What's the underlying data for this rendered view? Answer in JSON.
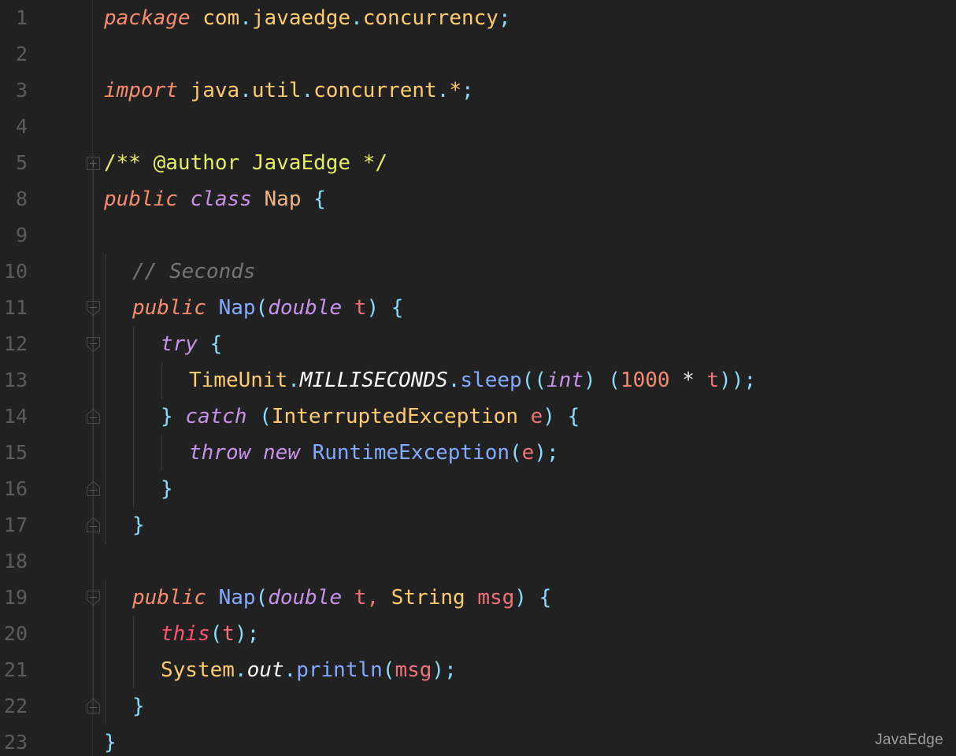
{
  "editor": {
    "language": "java",
    "filename": "Nap.java",
    "background": "#212121",
    "gutter_background": "#212121",
    "gutter_separator": "#2f2f2f",
    "line_number_color": "#5c5c5c",
    "line_height": 46,
    "font_size": 26
  },
  "watermark": {
    "text": "JavaEdge"
  },
  "gutter": {
    "line_numbers": [
      "1",
      "2",
      "3",
      "4",
      "5",
      "8",
      "9",
      "10",
      "11",
      "12",
      "13",
      "14",
      "15",
      "16",
      "17",
      "18",
      "19",
      "20",
      "21",
      "22",
      "23"
    ],
    "fold_markers": [
      {
        "line": "5",
        "row": 4,
        "type": "fold-collapsed-plus",
        "name": "fold-toggle-collapsed"
      },
      {
        "line": "11",
        "row": 8,
        "type": "fold-start",
        "name": "fold-toggle-start"
      },
      {
        "line": "12",
        "row": 9,
        "type": "fold-start",
        "name": "fold-toggle-start"
      },
      {
        "line": "14",
        "row": 11,
        "type": "fold-end",
        "name": "fold-toggle-end"
      },
      {
        "line": "16",
        "row": 13,
        "type": "fold-end",
        "name": "fold-toggle-end"
      },
      {
        "line": "17",
        "row": 14,
        "type": "fold-end",
        "name": "fold-toggle-end"
      },
      {
        "line": "19",
        "row": 16,
        "type": "fold-start",
        "name": "fold-toggle-start"
      },
      {
        "line": "22",
        "row": 19,
        "type": "fold-end",
        "name": "fold-toggle-end"
      }
    ]
  },
  "code_lines": [
    {
      "number": "1",
      "indent": 0,
      "tokens": [
        {
          "t": "package",
          "c": "t-kw"
        },
        {
          "t": " ",
          "c": "t-plain"
        },
        {
          "t": "com",
          "c": "t-pkg"
        },
        {
          "t": ".",
          "c": "t-punc"
        },
        {
          "t": "javaedge",
          "c": "t-pkg"
        },
        {
          "t": ".",
          "c": "t-punc"
        },
        {
          "t": "concurrency",
          "c": "t-pkg"
        },
        {
          "t": ";",
          "c": "t-punc"
        }
      ]
    },
    {
      "number": "2",
      "indent": 0,
      "tokens": []
    },
    {
      "number": "3",
      "indent": 0,
      "tokens": [
        {
          "t": "import",
          "c": "t-kw"
        },
        {
          "t": " ",
          "c": "t-plain"
        },
        {
          "t": "java",
          "c": "t-pkg"
        },
        {
          "t": ".",
          "c": "t-punc"
        },
        {
          "t": "util",
          "c": "t-pkg"
        },
        {
          "t": ".",
          "c": "t-punc"
        },
        {
          "t": "concurrent",
          "c": "t-pkg"
        },
        {
          "t": ".",
          "c": "t-punc"
        },
        {
          "t": "*",
          "c": "t-pkg"
        },
        {
          "t": ";",
          "c": "t-punc"
        }
      ]
    },
    {
      "number": "4",
      "indent": 0,
      "tokens": []
    },
    {
      "number": "5",
      "indent": 0,
      "tokens": [
        {
          "t": "/** @author JavaEdge */",
          "c": "t-doc"
        }
      ]
    },
    {
      "number": "8",
      "indent": 0,
      "tokens": [
        {
          "t": "public",
          "c": "t-kw"
        },
        {
          "t": " ",
          "c": "t-plain"
        },
        {
          "t": "class",
          "c": "t-kw2"
        },
        {
          "t": " ",
          "c": "t-plain"
        },
        {
          "t": "Nap",
          "c": "t-class"
        },
        {
          "t": " ",
          "c": "t-plain"
        },
        {
          "t": "{",
          "c": "t-brace"
        }
      ]
    },
    {
      "number": "9",
      "indent": 0,
      "tokens": []
    },
    {
      "number": "10",
      "indent": 1,
      "tokens": [
        {
          "t": "// Seconds",
          "c": "t-comment"
        }
      ]
    },
    {
      "number": "11",
      "indent": 1,
      "tokens": [
        {
          "t": "public",
          "c": "t-kw"
        },
        {
          "t": " ",
          "c": "t-plain"
        },
        {
          "t": "Nap",
          "c": "t-ctor"
        },
        {
          "t": "(",
          "c": "t-brace"
        },
        {
          "t": "double",
          "c": "t-kw2"
        },
        {
          "t": " ",
          "c": "t-plain"
        },
        {
          "t": "t",
          "c": "t-param"
        },
        {
          "t": ")",
          "c": "t-brace"
        },
        {
          "t": " ",
          "c": "t-plain"
        },
        {
          "t": "{",
          "c": "t-brace"
        }
      ]
    },
    {
      "number": "12",
      "indent": 2,
      "tokens": [
        {
          "t": "try",
          "c": "t-kw2"
        },
        {
          "t": " ",
          "c": "t-plain"
        },
        {
          "t": "{",
          "c": "t-brace"
        }
      ]
    },
    {
      "number": "13",
      "indent": 3,
      "tokens": [
        {
          "t": "TimeUnit",
          "c": "t-cls"
        },
        {
          "t": ".",
          "c": "t-punc"
        },
        {
          "t": "MILLISECONDS",
          "c": "t-static"
        },
        {
          "t": ".",
          "c": "t-punc"
        },
        {
          "t": "sleep",
          "c": "t-method"
        },
        {
          "t": "((",
          "c": "t-brace"
        },
        {
          "t": "int",
          "c": "t-kw2"
        },
        {
          "t": ")",
          "c": "t-brace"
        },
        {
          "t": " ",
          "c": "t-plain"
        },
        {
          "t": "(",
          "c": "t-brace"
        },
        {
          "t": "1000",
          "c": "t-num"
        },
        {
          "t": " ",
          "c": "t-plain"
        },
        {
          "t": "*",
          "c": "t-op"
        },
        {
          "t": " ",
          "c": "t-plain"
        },
        {
          "t": "t",
          "c": "t-param"
        },
        {
          "t": "))",
          "c": "t-brace"
        },
        {
          "t": ";",
          "c": "t-punc"
        }
      ]
    },
    {
      "number": "14",
      "indent": 2,
      "tokens": [
        {
          "t": "}",
          "c": "t-brace"
        },
        {
          "t": " ",
          "c": "t-plain"
        },
        {
          "t": "catch",
          "c": "t-kw2"
        },
        {
          "t": " ",
          "c": "t-plain"
        },
        {
          "t": "(",
          "c": "t-brace"
        },
        {
          "t": "InterruptedException",
          "c": "t-type"
        },
        {
          "t": " ",
          "c": "t-plain"
        },
        {
          "t": "e",
          "c": "t-param"
        },
        {
          "t": ")",
          "c": "t-brace"
        },
        {
          "t": " ",
          "c": "t-plain"
        },
        {
          "t": "{",
          "c": "t-brace"
        }
      ]
    },
    {
      "number": "15",
      "indent": 3,
      "tokens": [
        {
          "t": "throw",
          "c": "t-kw2"
        },
        {
          "t": " ",
          "c": "t-plain"
        },
        {
          "t": "new",
          "c": "t-kw2"
        },
        {
          "t": " ",
          "c": "t-plain"
        },
        {
          "t": "RuntimeException",
          "c": "t-ctor"
        },
        {
          "t": "(",
          "c": "t-brace"
        },
        {
          "t": "e",
          "c": "t-param"
        },
        {
          "t": ")",
          "c": "t-brace"
        },
        {
          "t": ";",
          "c": "t-punc"
        }
      ]
    },
    {
      "number": "16",
      "indent": 2,
      "tokens": [
        {
          "t": "}",
          "c": "t-brace"
        }
      ]
    },
    {
      "number": "17",
      "indent": 1,
      "tokens": [
        {
          "t": "}",
          "c": "t-brace"
        }
      ]
    },
    {
      "number": "18",
      "indent": 0,
      "tokens": []
    },
    {
      "number": "19",
      "indent": 1,
      "tokens": [
        {
          "t": "public",
          "c": "t-kw"
        },
        {
          "t": " ",
          "c": "t-plain"
        },
        {
          "t": "Nap",
          "c": "t-ctor"
        },
        {
          "t": "(",
          "c": "t-brace"
        },
        {
          "t": "double",
          "c": "t-kw2"
        },
        {
          "t": " ",
          "c": "t-plain"
        },
        {
          "t": "t",
          "c": "t-param"
        },
        {
          "t": ",",
          "c": "t-param"
        },
        {
          "t": " ",
          "c": "t-plain"
        },
        {
          "t": "String",
          "c": "t-type"
        },
        {
          "t": " ",
          "c": "t-plain"
        },
        {
          "t": "msg",
          "c": "t-param"
        },
        {
          "t": ")",
          "c": "t-brace"
        },
        {
          "t": " ",
          "c": "t-plain"
        },
        {
          "t": "{",
          "c": "t-brace"
        }
      ]
    },
    {
      "number": "20",
      "indent": 2,
      "tokens": [
        {
          "t": "this",
          "c": "t-this"
        },
        {
          "t": "(",
          "c": "t-brace"
        },
        {
          "t": "t",
          "c": "t-param"
        },
        {
          "t": ")",
          "c": "t-brace"
        },
        {
          "t": ";",
          "c": "t-punc"
        }
      ]
    },
    {
      "number": "21",
      "indent": 2,
      "tokens": [
        {
          "t": "System",
          "c": "t-cls"
        },
        {
          "t": ".",
          "c": "t-punc"
        },
        {
          "t": "out",
          "c": "t-static"
        },
        {
          "t": ".",
          "c": "t-punc"
        },
        {
          "t": "println",
          "c": "t-method"
        },
        {
          "t": "(",
          "c": "t-brace"
        },
        {
          "t": "msg",
          "c": "t-param"
        },
        {
          "t": ")",
          "c": "t-brace"
        },
        {
          "t": ";",
          "c": "t-punc"
        }
      ]
    },
    {
      "number": "22",
      "indent": 1,
      "tokens": [
        {
          "t": "}",
          "c": "t-brace"
        }
      ]
    },
    {
      "number": "23",
      "indent": 0,
      "tokens": [
        {
          "t": "}",
          "c": "t-brace"
        }
      ]
    }
  ]
}
